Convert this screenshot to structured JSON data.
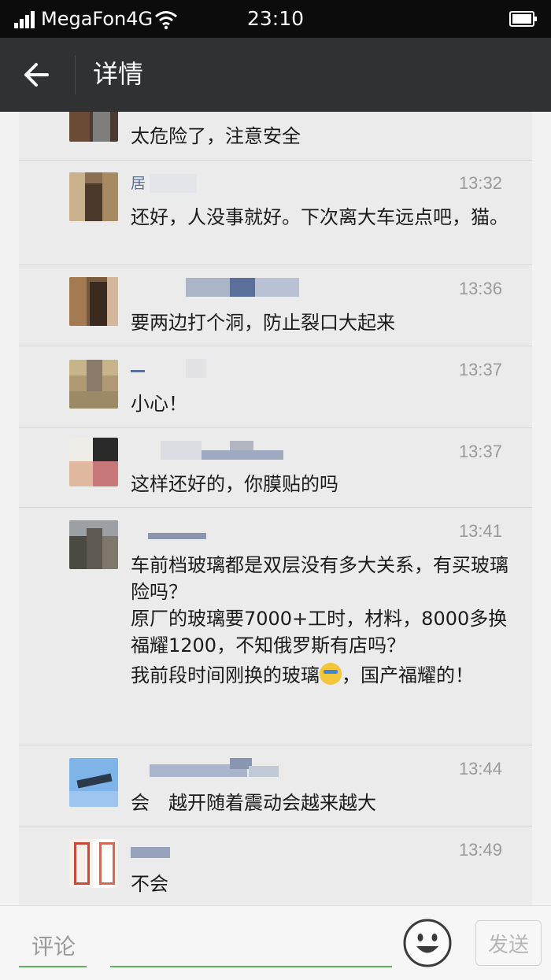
{
  "status_bar": {
    "carrier": "MegaFon4G",
    "time": "23:10"
  },
  "header": {
    "title": "详情"
  },
  "comments": [
    {
      "user": "",
      "time": "",
      "text": [
        "太危险了，注意安全"
      ]
    },
    {
      "user": "居",
      "time": "13:32",
      "text": [
        "还好，人没事就好。下次离大车远点吧，猫。"
      ]
    },
    {
      "user": "",
      "time": "13:36",
      "text": [
        "要两边打个洞，防止裂口大起来"
      ]
    },
    {
      "user": "",
      "time": "13:37",
      "text": [
        "小心！"
      ]
    },
    {
      "user": "",
      "time": "13:37",
      "text": [
        "这样还好的，你膜贴的吗"
      ]
    },
    {
      "user": "",
      "time": "13:41",
      "text": [
        "车前档玻璃都是双层没有多大关系，有买玻璃险吗？",
        "原厂的玻璃要7000+工时，材料，8000多换福耀1200，不知俄罗斯有店吗？",
        "我前段时间刚换的玻璃",
        "，国产福耀的！"
      ]
    },
    {
      "user": "",
      "time": "13:44",
      "text": [
        "会　越开随着震动会越来越大"
      ]
    },
    {
      "user": "",
      "time": "13:49",
      "text": [
        "不会"
      ]
    }
  ],
  "input": {
    "label": "评论",
    "placeholder": "",
    "value": ""
  },
  "send_button": {
    "label": "发送"
  },
  "colors": {
    "title_bar": "#2f3133",
    "accent_green": "#5fb35f",
    "username_blue": "#5a7099",
    "emoji": "#f2c53a"
  },
  "icons": [
    "signal-icon",
    "wifi-icon",
    "battery-icon",
    "back-arrow-icon",
    "smiley-face-icon",
    "crying-face-emoji"
  ]
}
